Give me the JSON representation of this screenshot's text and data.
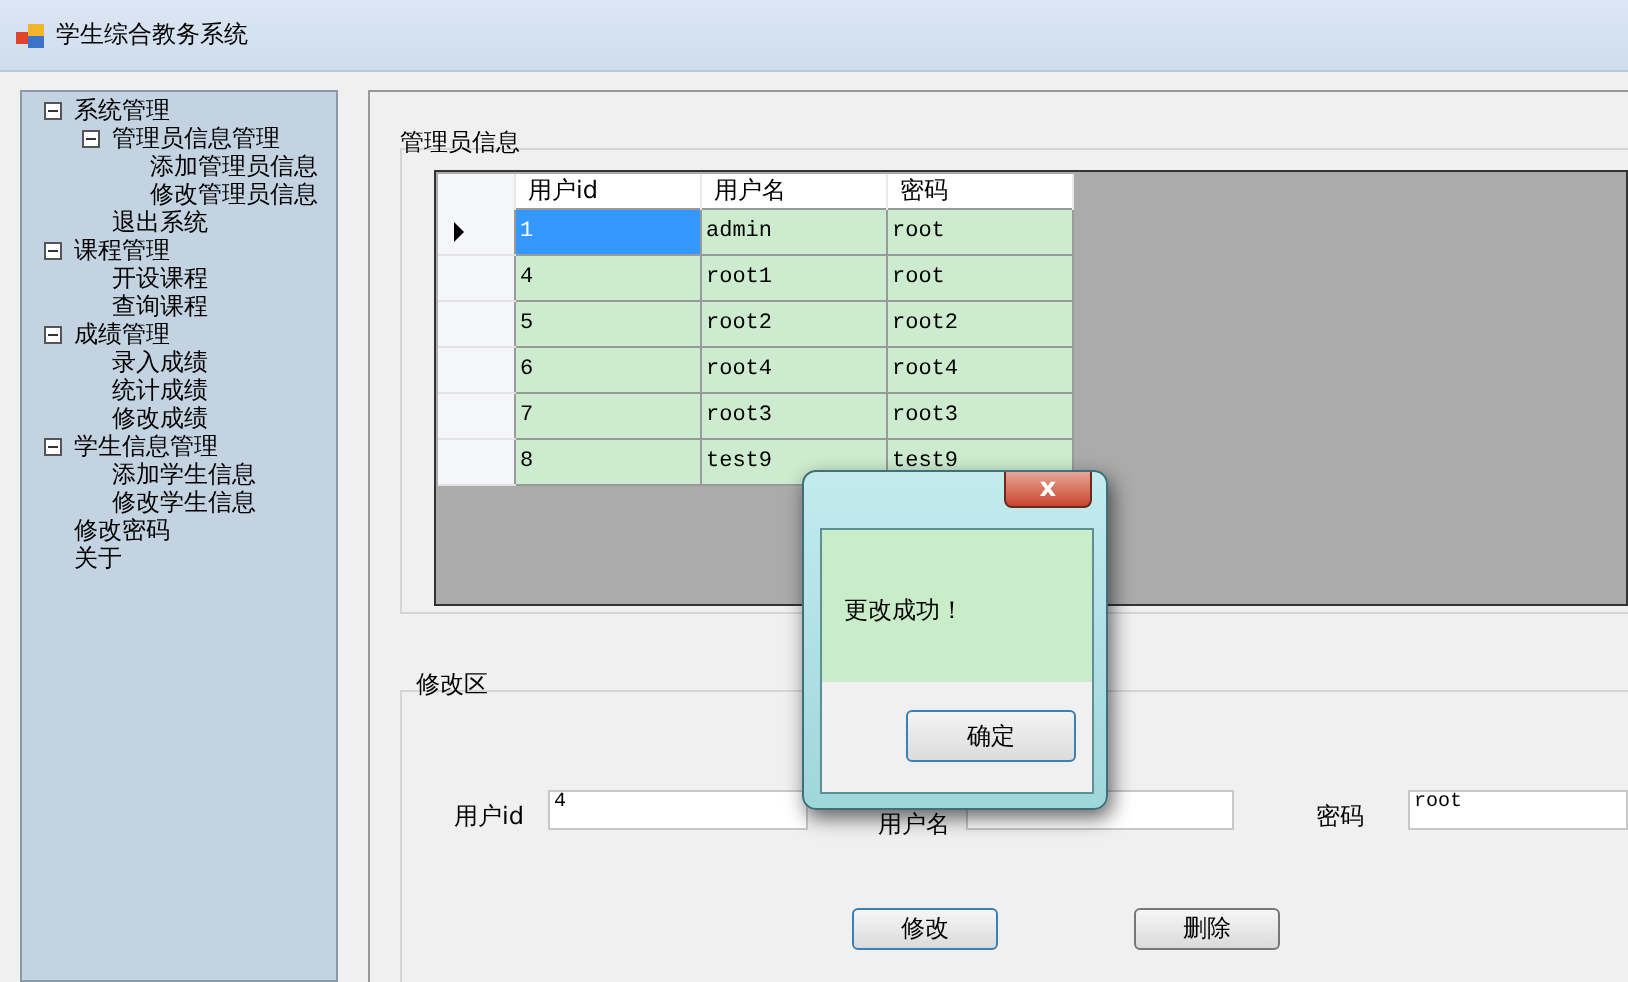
{
  "window": {
    "title": "学生综合教务系统"
  },
  "tree": [
    {
      "label": "系统管理",
      "expanded": true,
      "children": [
        {
          "label": "管理员信息管理",
          "expanded": true,
          "children": [
            {
              "label": "添加管理员信息"
            },
            {
              "label": "修改管理员信息"
            }
          ]
        },
        {
          "label": "退出系统"
        }
      ]
    },
    {
      "label": "课程管理",
      "expanded": true,
      "children": [
        {
          "label": "开设课程"
        },
        {
          "label": "查询课程"
        }
      ]
    },
    {
      "label": "成绩管理",
      "expanded": true,
      "children": [
        {
          "label": "录入成绩"
        },
        {
          "label": "统计成绩"
        },
        {
          "label": "修改成绩"
        }
      ]
    },
    {
      "label": "学生信息管理",
      "expanded": true,
      "children": [
        {
          "label": "添加学生信息"
        },
        {
          "label": "修改学生信息"
        }
      ]
    },
    {
      "label": "修改密码"
    },
    {
      "label": "关于"
    }
  ],
  "admin_group": {
    "title": "管理员信息",
    "columns": [
      "用户id",
      "用户名",
      "密码"
    ],
    "rows": [
      {
        "selected": true,
        "cells": [
          "1",
          "admin",
          "root"
        ]
      },
      {
        "selected": false,
        "cells": [
          "4",
          "root1",
          "root"
        ]
      },
      {
        "selected": false,
        "cells": [
          "5",
          "root2",
          "root2"
        ]
      },
      {
        "selected": false,
        "cells": [
          "6",
          "root4",
          "root4"
        ]
      },
      {
        "selected": false,
        "cells": [
          "7",
          "root3",
          "root3"
        ]
      },
      {
        "selected": false,
        "cells": [
          "8",
          "test9",
          "test9"
        ]
      }
    ]
  },
  "edit_group": {
    "title": "修改区",
    "fields": [
      {
        "label": "用户id",
        "value": "4"
      },
      {
        "label": "用户名"
      },
      {
        "label": "密码",
        "value": "root"
      }
    ],
    "buttons": [
      "修改",
      "删除"
    ]
  },
  "dialog": {
    "close": "x",
    "message": "更改成功！",
    "button": "确定"
  }
}
